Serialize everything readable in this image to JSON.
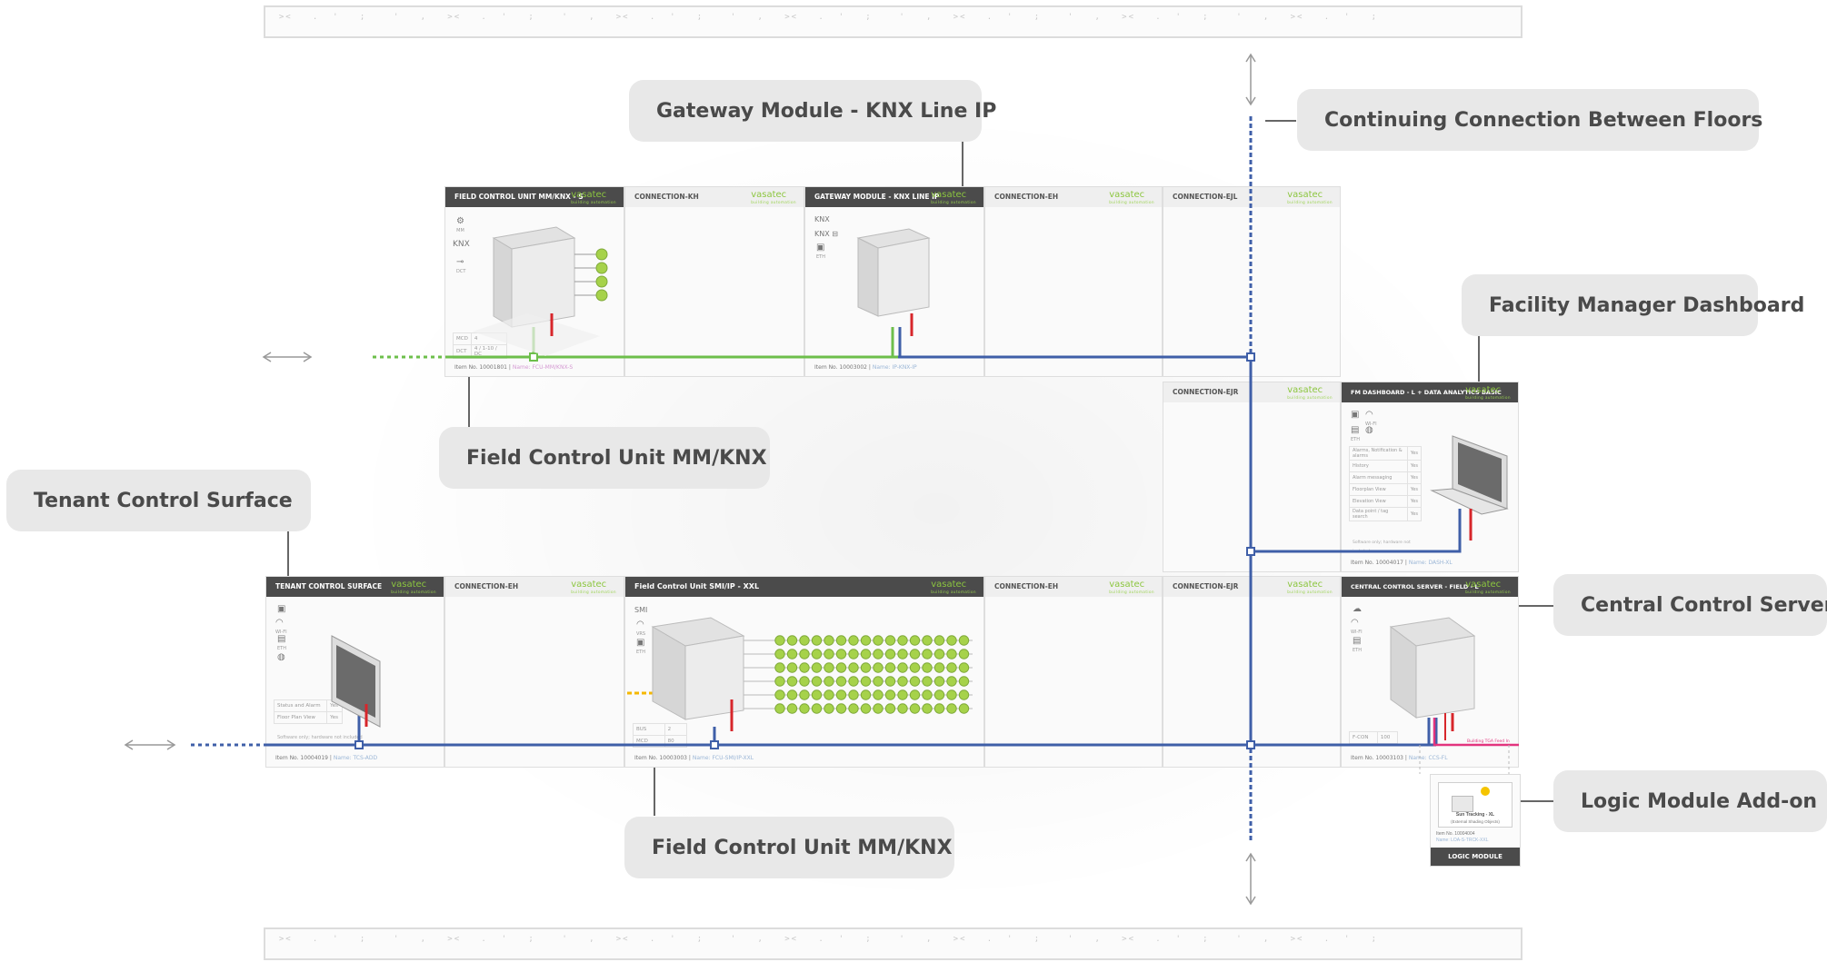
{
  "callouts": {
    "gateway": "Gateway Module - KNX Line IP",
    "continuing": "Continuing Connection Between Floors",
    "fm_dashboard": "Facility Manager Dashboard",
    "fcu_upper": "Field Control Unit MM/KNX",
    "tenant": "Tenant Control Surface",
    "central": "Central Control Server",
    "logic": "Logic Module Add-on",
    "fcu_lower": "Field Control Unit MM/KNX"
  },
  "brand": {
    "name": "vasatec",
    "tagline": "building automation"
  },
  "panels": {
    "fcu_s": {
      "title": "FIELD CONTROL UNIT MM/KNX - S",
      "item": "Item No. 10001801",
      "name": "Name: FCU-MM/KNX-S",
      "icon_mm": "MM",
      "icon_knx": "KNX",
      "icon_dct": "DCT",
      "row1_label": "MCD",
      "row1_val": "4",
      "row2_label": "DCT",
      "row2_val": "4 / 1-10 / DC"
    },
    "conn_kh": {
      "title": "CONNECTION-KH"
    },
    "gateway": {
      "title": "GATEWAY MODULE - KNX LINE IP",
      "item": "Item No. 10003002",
      "name": "Name: IP-KNX-IP",
      "icon_knx": "KNX",
      "icon_knx2": "KNX",
      "icon_eth": "ETH"
    },
    "conn_eh_top": {
      "title": "CONNECTION-EH"
    },
    "conn_ejl": {
      "title": "CONNECTION-EJL"
    },
    "conn_ejr_mid": {
      "title": "CONNECTION-EJR"
    },
    "fm_dash": {
      "title": "FM DASHBOARD - L + DATA ANALYTICS BASIC",
      "item": "Item No. 10004017",
      "name": "Name: DASH-XL",
      "icon_wifi": "WI-FI",
      "icon_eth": "ETH",
      "rows": [
        {
          "label": "Alarms, Notification & alarms",
          "val": "Yes"
        },
        {
          "label": "History",
          "val": "Yes"
        },
        {
          "label": "Alarm messaging",
          "val": "Yes"
        },
        {
          "label": "Floorplan View",
          "val": "Yes"
        },
        {
          "label": "Elevation View",
          "val": "Yes"
        },
        {
          "label": "Data point / tag search",
          "val": "Yes"
        }
      ],
      "note": "Software only; hardware not included"
    },
    "tenant": {
      "title": "TENANT CONTROL SURFACE",
      "item": "Item No. 10004019",
      "name": "Name: TCS-ADD",
      "icon_wifi": "WI-FI",
      "icon_eth": "ETH",
      "rows": [
        {
          "label": "Status and Alarm",
          "val": "Yes"
        },
        {
          "label": "Floor Plan View",
          "val": "Yes"
        }
      ],
      "note": "Software only; hardware not included"
    },
    "conn_eh_b1": {
      "title": "CONNECTION-EH"
    },
    "fcu_xxl": {
      "title": "Field Control Unit SMI/IP - XXL",
      "item": "Item No. 10003003",
      "name": "Name: FCU-SMI/IP-XXL",
      "icon_smi": "SMI",
      "icon_vrs": "VRS",
      "icon_eth": "ETH",
      "row1_label": "BUS",
      "row1_val": "2",
      "row2_label": "MCD",
      "row2_val": "80"
    },
    "conn_eh_b2": {
      "title": "CONNECTION-EH"
    },
    "conn_ejr_b": {
      "title": "CONNECTION-EJR"
    },
    "central": {
      "title": "CENTRAL CONTROL SERVER - FIELD - L",
      "item": "Item No. 10003103",
      "name": "Name: CCS-FL",
      "icon_wifi": "WI-FI",
      "icon_eth": "ETH",
      "row_label": "F-CON",
      "row_val": "100",
      "feed_label": "Building TGA Feed In"
    }
  },
  "logic": {
    "inner_title": "Sun Tracking - XL",
    "inner_sub": "(External Shading Objects)",
    "item": "Item No. 10004004",
    "name": "Name: LOA-S-TRCK-XXL",
    "footer": "LOGIC MODULE"
  },
  "colors": {
    "green": "#6dbf4b",
    "blue": "#3f5fa8",
    "red": "#d7262b",
    "pink": "#e2347e",
    "yellow": "#f5b800",
    "motor": "#a6d24a"
  }
}
